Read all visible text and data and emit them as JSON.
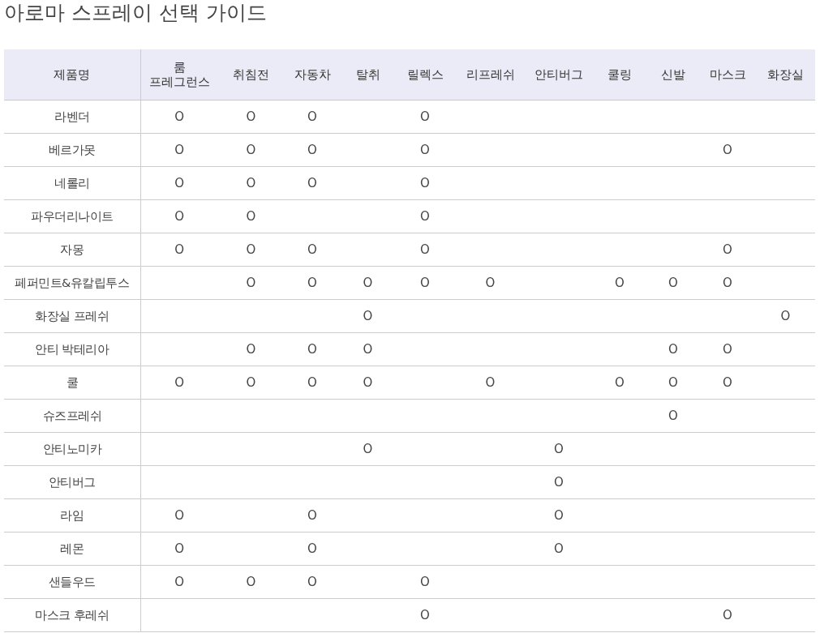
{
  "title": "아로마 스프레이 선택 가이드",
  "columns": [
    "제품명",
    "룸\n프레그런스",
    "취침전",
    "자동차",
    "탈취",
    "릴렉스",
    "리프레쉬",
    "안티버그",
    "쿨링",
    "신발",
    "마스크",
    "화장실"
  ],
  "rows": [
    {
      "name": "라벤더",
      "cells": [
        "O",
        "O",
        "O",
        null,
        "O",
        null,
        null,
        null,
        null,
        null,
        null
      ]
    },
    {
      "name": "베르가못",
      "cells": [
        "O",
        "O",
        "O",
        null,
        "O",
        null,
        null,
        null,
        null,
        "O",
        null
      ]
    },
    {
      "name": "네롤리",
      "cells": [
        "O",
        "O",
        "O",
        null,
        "O",
        null,
        null,
        null,
        null,
        null,
        null
      ]
    },
    {
      "name": "파우더리나이트",
      "cells": [
        "O",
        "O",
        null,
        null,
        "O",
        null,
        null,
        null,
        null,
        null,
        null
      ]
    },
    {
      "name": "자몽",
      "cells": [
        "O",
        "O",
        "O",
        null,
        "O",
        null,
        null,
        null,
        null,
        "O",
        null
      ]
    },
    {
      "name": "페퍼민트&유칼립투스",
      "cells": [
        null,
        "O",
        "O",
        "O",
        "O",
        "O",
        null,
        "O",
        "O",
        "O",
        null
      ]
    },
    {
      "name": "화장실 프레쉬",
      "cells": [
        null,
        null,
        null,
        "O",
        null,
        null,
        null,
        null,
        null,
        null,
        "O"
      ]
    },
    {
      "name": "안티 박테리아",
      "cells": [
        null,
        "O",
        "O",
        "O",
        null,
        null,
        null,
        null,
        "O",
        "O",
        null
      ]
    },
    {
      "name": "쿨",
      "cells": [
        "O",
        "O",
        "O",
        "O",
        null,
        "O",
        null,
        "O",
        "O",
        "O",
        null
      ]
    },
    {
      "name": "슈즈프레쉬",
      "cells": [
        null,
        null,
        null,
        null,
        null,
        null,
        null,
        null,
        "O",
        null,
        null
      ]
    },
    {
      "name": "안티노미카",
      "cells": [
        null,
        null,
        null,
        "O",
        null,
        null,
        "O",
        null,
        null,
        null,
        null
      ]
    },
    {
      "name": "안티버그",
      "cells": [
        null,
        null,
        null,
        null,
        null,
        null,
        "O",
        null,
        null,
        null,
        null
      ]
    },
    {
      "name": "라임",
      "cells": [
        "O",
        null,
        "O",
        null,
        null,
        null,
        "O",
        null,
        null,
        null,
        null
      ]
    },
    {
      "name": "레몬",
      "cells": [
        "O",
        null,
        "O",
        null,
        null,
        null,
        "O",
        null,
        null,
        null,
        null
      ]
    },
    {
      "name": "샌들우드",
      "cells": [
        "O",
        "O",
        "O",
        null,
        "O",
        null,
        null,
        null,
        null,
        null,
        null
      ]
    },
    {
      "name": "마스크 후레쉬",
      "cells": [
        null,
        null,
        null,
        null,
        "O",
        null,
        null,
        null,
        null,
        "O",
        null
      ]
    }
  ]
}
